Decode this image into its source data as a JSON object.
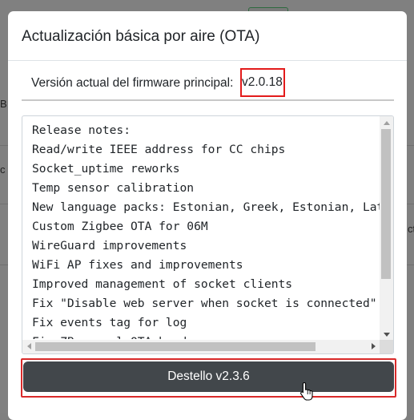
{
  "modal": {
    "title": "Actualización básica por aire (OTA)",
    "version_label": "Versión actual del firmware principal:",
    "version_value": "v2.0.18",
    "release_notes": [
      "Release notes:",
      "Read/write IEEE address for CC chips",
      "Socket_uptime reworks",
      "Temp sensor calibration",
      "New language packs: Estonian, Greek, Estonian, Latvian",
      "Custom Zigbee OTA for 06M",
      "WireGuard improvements",
      "WiFi AP fixes and improvements",
      "Improved management of socket clients",
      "Fix \"Disable web server when socket is connected\"",
      "Fix events tag for log",
      "Fix ZB manual OTA header"
    ],
    "flash_button_label": "Destello v2.3.6"
  },
  "background": {
    "fragments": [
      "B",
      "c",
      "ct"
    ]
  },
  "colors": {
    "highlight": "#e31b1b",
    "button_bg": "#42474b"
  },
  "icons": [
    "hand-pointer-cursor-icon",
    "scroll-up-arrow-icon",
    "scroll-down-arrow-icon",
    "scroll-left-arrow-icon",
    "scroll-right-arrow-icon"
  ]
}
